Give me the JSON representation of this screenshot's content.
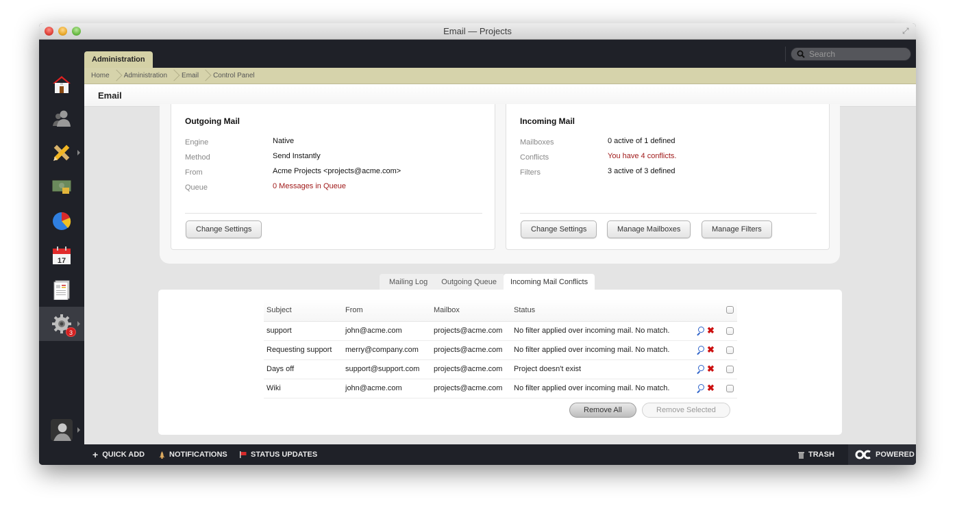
{
  "window": {
    "title": "Email — Projects"
  },
  "topbar": {
    "tab_label": "Administration",
    "search_placeholder": "Search"
  },
  "breadcrumb": [
    "Home",
    "Administration",
    "Email",
    "Control Panel"
  ],
  "page": {
    "title": "Email"
  },
  "sidebar": {
    "items": [
      {
        "name": "home",
        "icon": "home-icon"
      },
      {
        "name": "people",
        "icon": "people-icon"
      },
      {
        "name": "projects",
        "icon": "pencil-ruler-icon",
        "has_submenu": true
      },
      {
        "name": "finance",
        "icon": "money-icon"
      },
      {
        "name": "reports",
        "icon": "pie-chart-icon"
      },
      {
        "name": "calendar",
        "icon": "calendar-icon",
        "label": "17"
      },
      {
        "name": "documents",
        "icon": "document-icon"
      },
      {
        "name": "settings",
        "icon": "gear-icon",
        "badge": "3",
        "active": true,
        "has_submenu": true
      }
    ],
    "profile": {
      "icon": "avatar-icon",
      "has_submenu": true
    }
  },
  "outgoing": {
    "title": "Outgoing Mail",
    "rows": [
      {
        "label": "Engine",
        "value": "Native"
      },
      {
        "label": "Method",
        "value": "Send Instantly"
      },
      {
        "label": "From",
        "value": "Acme Projects <projects@acme.com>"
      },
      {
        "label": "Queue",
        "value": "0 Messages in Queue",
        "alert": true
      }
    ],
    "buttons": [
      "Change Settings"
    ]
  },
  "incoming": {
    "title": "Incoming Mail",
    "rows": [
      {
        "label": "Mailboxes",
        "value": "0 active of 1 defined"
      },
      {
        "label": "Conflicts",
        "value": "You have 4 conflicts.",
        "alert": true
      },
      {
        "label": "Filters",
        "value": "3 active of 3 defined"
      }
    ],
    "buttons": [
      "Change Settings",
      "Manage Mailboxes",
      "Manage Filters"
    ]
  },
  "tabs": [
    {
      "label": "Mailing Log"
    },
    {
      "label": "Outgoing Queue"
    },
    {
      "label": "Incoming Mail Conflicts",
      "active": true
    }
  ],
  "conflicts": {
    "columns": [
      "Subject",
      "From",
      "Mailbox",
      "Status"
    ],
    "rows": [
      {
        "subject": "support",
        "from": "john@acme.com",
        "mailbox": "projects@acme.com",
        "status": "No filter applied over incoming mail. No match."
      },
      {
        "subject": "Requesting support",
        "from": "merry@company.com",
        "mailbox": "projects@acme.com",
        "status": "No filter applied over incoming mail. No match."
      },
      {
        "subject": "Days off",
        "from": "support@support.com",
        "mailbox": "projects@acme.com",
        "status": "Project doesn't exist"
      },
      {
        "subject": "Wiki",
        "from": "john@acme.com",
        "mailbox": "projects@acme.com",
        "status": "No filter applied over incoming mail. No match."
      }
    ],
    "remove_all": "Remove All",
    "remove_selected": "Remove Selected"
  },
  "footer": {
    "quick_add": "QUICK ADD",
    "notifications": "NOTIFICATIONS",
    "status_updates": "STATUS UPDATES",
    "trash": "TRASH",
    "powered": "POWERED"
  },
  "colors": {
    "alert": "#a01a1a",
    "accent_tab": "#d4d1a6",
    "dark": "#1f2128"
  }
}
